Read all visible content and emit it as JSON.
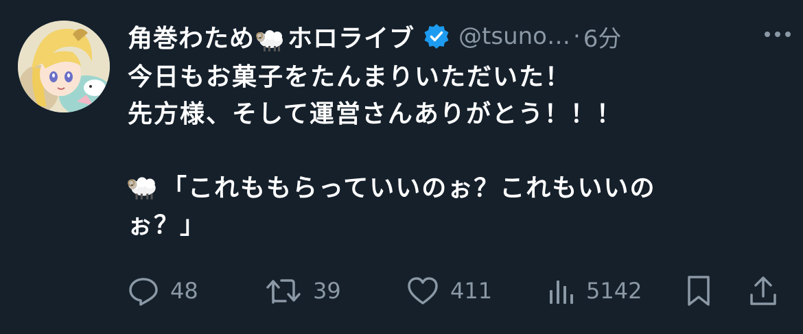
{
  "tweet": {
    "author": {
      "name_part1": "角巻わため",
      "name_part2": "ホロライブ",
      "handle": "@tsuno…",
      "separator": "·",
      "time": "6分"
    },
    "text": {
      "line1": "今日もお菓子をたんまりいただいた！",
      "line2": "先方様、そして運営さんありがとう！！！",
      "line3": "",
      "line4": "「これももらっていいのぉ？これもいいの",
      "line5": "ぉ？」"
    },
    "actions": {
      "replies": "48",
      "retweets": "39",
      "likes": "411",
      "views": "5142"
    }
  },
  "colors": {
    "background": "#15202b",
    "text": "#ffffff",
    "muted": "#8b98a5",
    "verified": "#1d9bf0"
  },
  "icons": [
    "sheep-emoji-icon",
    "verified-badge-icon",
    "more-options-icon",
    "reply-icon",
    "retweet-icon",
    "like-icon",
    "views-icon",
    "bookmark-icon",
    "share-icon"
  ]
}
